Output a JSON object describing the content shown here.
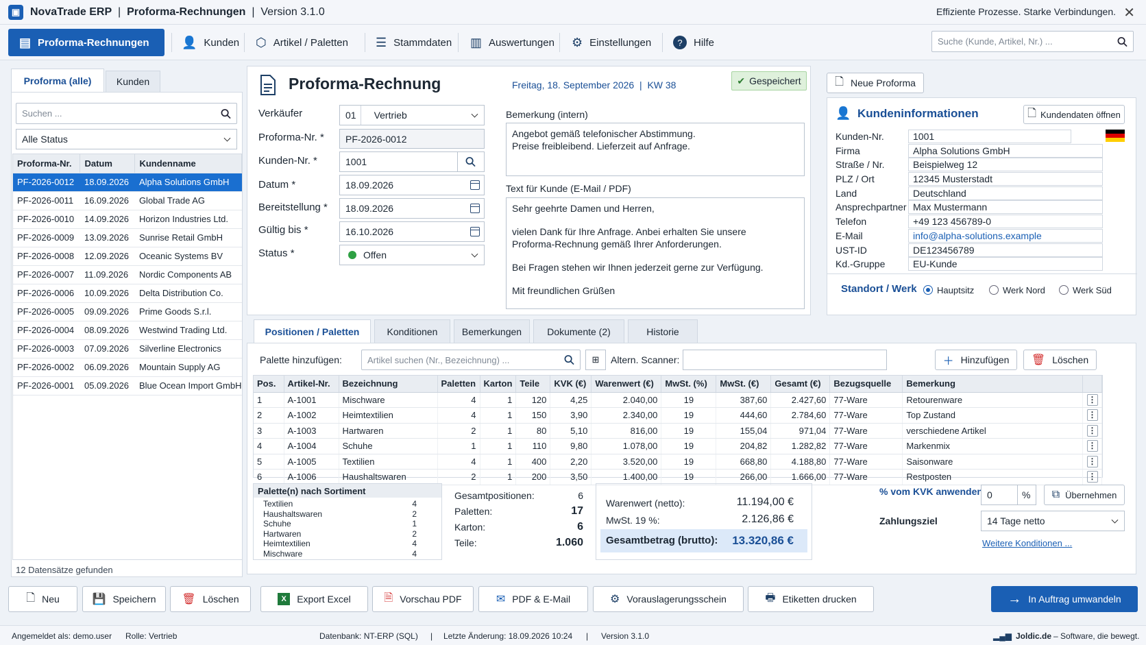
{
  "window": {
    "app": "NovaTrade ERP",
    "module": "Proforma-Rechnungen",
    "version": "Version 3.1.0",
    "tagline": "Effiziente Prozesse. Starke Verbindungen."
  },
  "nav": {
    "items": [
      "Proforma-Rechnungen",
      "Kunden",
      "Artikel / Paletten",
      "Stammdaten",
      "Auswertungen",
      "Einstellungen",
      "Hilfe"
    ],
    "search_placeholder": "Suche (Kunde, Artikel, Nr.) ..."
  },
  "left": {
    "tabs": [
      "Proforma (alle)",
      "Kunden"
    ],
    "search_placeholder": "Suchen ...",
    "status_filter": "Alle Status",
    "columns": [
      "Proforma-Nr.",
      "Datum",
      "Kundenname"
    ],
    "rows": [
      [
        "PF-2026-0012",
        "18.09.2026",
        "Alpha Solutions GmbH"
      ],
      [
        "PF-2026-0011",
        "16.09.2026",
        "Global Trade AG"
      ],
      [
        "PF-2026-0010",
        "14.09.2026",
        "Horizon Industries Ltd."
      ],
      [
        "PF-2026-0009",
        "13.09.2026",
        "Sunrise Retail GmbH"
      ],
      [
        "PF-2026-0008",
        "12.09.2026",
        "Oceanic Systems BV"
      ],
      [
        "PF-2026-0007",
        "11.09.2026",
        "Nordic Components AB"
      ],
      [
        "PF-2026-0006",
        "10.09.2026",
        "Delta Distribution Co."
      ],
      [
        "PF-2026-0005",
        "09.09.2026",
        "Prime Goods S.r.l."
      ],
      [
        "PF-2026-0004",
        "08.09.2026",
        "Westwind Trading Ltd."
      ],
      [
        "PF-2026-0003",
        "07.09.2026",
        "Silverline Electronics"
      ],
      [
        "PF-2026-0002",
        "06.09.2026",
        "Mountain Supply AG"
      ],
      [
        "PF-2026-0001",
        "05.09.2026",
        "Blue Ocean Import GmbH"
      ]
    ],
    "count": "12 Datensätze gefunden"
  },
  "header": {
    "title": "Proforma-Rechnung",
    "date": "Freitag, 18. September 2026",
    "week": "KW 38",
    "saved": "Gespeichert"
  },
  "form": {
    "labels": [
      "Verkäufer",
      "Proforma-Nr. *",
      "Kunden-Nr. *",
      "Datum *",
      "Bereitstellung *",
      "Gültig bis *",
      "Status *"
    ],
    "seller_code": "01",
    "seller_name": "Vertrieb",
    "proforma_nr": "PF-2026-0012",
    "kunden_nr": "1001",
    "datum": "18.09.2026",
    "bereitstellung": "18.09.2026",
    "gueltig": "16.10.2026",
    "status": "Offen"
  },
  "remarks": {
    "internal_label": "Bemerkung (intern)",
    "internal_lines": [
      "Angebot gemäß telefonischer Abstimmung.",
      "Preise freibleibend. Lieferzeit auf Anfrage."
    ],
    "customer_label": "Text für Kunde (E-Mail / PDF)",
    "customer_lines": [
      "Sehr geehrte Damen und Herren,",
      "vielen Dank für Ihre Anfrage. Anbei erhalten Sie unsere",
      "Proforma-Rechnung gemäß Ihrer Anforderungen.",
      "Bei Fragen stehen wir Ihnen jederzeit gerne zur Verfügung.",
      "Mit freundlichen Grüßen"
    ]
  },
  "customer": {
    "new_btn": "Neue Proforma",
    "title": "Kundeninformationen",
    "open_btn": "Kundendaten öffnen",
    "fields": [
      [
        "Kunden-Nr.",
        "1001"
      ],
      [
        "Firma",
        "Alpha Solutions GmbH"
      ],
      [
        "Straße / Nr.",
        "Beispielweg 12"
      ],
      [
        "PLZ / Ort",
        "12345 Musterstadt"
      ],
      [
        "Land",
        "Deutschland"
      ],
      [
        "Ansprechpartner",
        "Max Mustermann"
      ],
      [
        "Telefon",
        "+49 123 456789-0"
      ],
      [
        "E-Mail",
        "info@alpha-solutions.example"
      ],
      [
        "UST-ID",
        "DE123456789"
      ],
      [
        "Kd.-Gruppe",
        "EU-Kunde"
      ]
    ],
    "site_label": "Standort / Werk",
    "sites": [
      "Hauptsitz",
      "Werk Nord",
      "Werk Süd"
    ]
  },
  "tabs2": [
    "Positionen / Paletten",
    "Konditionen",
    "Bemerkungen",
    "Dokumente (2)",
    "Historie"
  ],
  "pos_tools": {
    "add_label": "Palette hinzufügen:",
    "search_placeholder": "Artikel suchen (Nr., Bezeichnung) ...",
    "scanner_label": "Altern. Scanner:",
    "add_btn": "Hinzufügen",
    "del_btn": "Löschen"
  },
  "positions": {
    "columns": [
      "Pos.",
      "Artikel-Nr.",
      "Bezeichnung",
      "Paletten",
      "Karton",
      "Teile",
      "KVK (€)",
      "Warenwert (€)",
      "MwSt. (%)",
      "MwSt. (€)",
      "Gesamt (€)",
      "Bezugsquelle",
      "Bemerkung"
    ],
    "rows": [
      [
        "1",
        "A-1001",
        "Mischware",
        "4",
        "1",
        "120",
        "4,25",
        "2.040,00",
        "19",
        "387,60",
        "2.427,60",
        "77-Ware",
        "Retourenware"
      ],
      [
        "2",
        "A-1002",
        "Heimtextilien",
        "4",
        "1",
        "150",
        "3,90",
        "2.340,00",
        "19",
        "444,60",
        "2.784,60",
        "77-Ware",
        "Top Zustand"
      ],
      [
        "3",
        "A-1003",
        "Hartwaren",
        "2",
        "1",
        "80",
        "5,10",
        "816,00",
        "19",
        "155,04",
        "971,04",
        "77-Ware",
        "verschiedene Artikel"
      ],
      [
        "4",
        "A-1004",
        "Schuhe",
        "1",
        "1",
        "110",
        "9,80",
        "1.078,00",
        "19",
        "204,82",
        "1.282,82",
        "77-Ware",
        "Markenmix"
      ],
      [
        "5",
        "A-1005",
        "Textilien",
        "4",
        "1",
        "400",
        "2,20",
        "3.520,00",
        "19",
        "668,80",
        "4.188,80",
        "77-Ware",
        "Saisonware"
      ],
      [
        "6",
        "A-1006",
        "Haushaltswaren",
        "2",
        "1",
        "200",
        "3,50",
        "1.400,00",
        "19",
        "266,00",
        "1.666,00",
        "77-Ware",
        "Restposten"
      ]
    ]
  },
  "sortiment": {
    "title": "Palette(n) nach Sortiment",
    "rows": [
      [
        "Textilien",
        "4"
      ],
      [
        "Haushaltswaren",
        "2"
      ],
      [
        "Schuhe",
        "1"
      ],
      [
        "Hartwaren",
        "2"
      ],
      [
        "Heimtextilien",
        "4"
      ],
      [
        "Mischware",
        "4"
      ]
    ]
  },
  "totals": {
    "rows": [
      [
        "Gesamtpositionen:",
        "6"
      ],
      [
        "Paletten:",
        "17"
      ],
      [
        "Karton:",
        "6"
      ],
      [
        "Teile:",
        "1.060"
      ]
    ],
    "net_label": "Warenwert (netto):",
    "net": "11.194,00 €",
    "vat_label": "MwSt. 19 %:",
    "vat": "2.126,86 €",
    "gross_label": "Gesamtbetrag (brutto):",
    "gross": "13.320,86 €"
  },
  "conditions": {
    "kvk_label": "% vom KVK anwenden",
    "kvk_value": "0",
    "pct": "%",
    "apply_btn": "Übernehmen",
    "term_label": "Zahlungsziel",
    "term_value": "14 Tage netto",
    "more_link": "Weitere Konditionen ..."
  },
  "actions": [
    "Neu",
    "Speichern",
    "Löschen",
    "Export Excel",
    "Vorschau PDF",
    "PDF & E-Mail",
    "Vorauslagerungsschein",
    "Etiketten drucken",
    "In Auftrag umwandeln"
  ],
  "status": {
    "user": "Angemeldet als: demo.user",
    "role": "Rolle: Vertrieb",
    "db": "Datenbank: NT-ERP (SQL)",
    "last": "Letzte Änderung: 18.09.2026 10:24",
    "version": "Version 3.1.0",
    "brand": "Joldic.de",
    "brand_tag": "–  Software, die bewegt."
  }
}
